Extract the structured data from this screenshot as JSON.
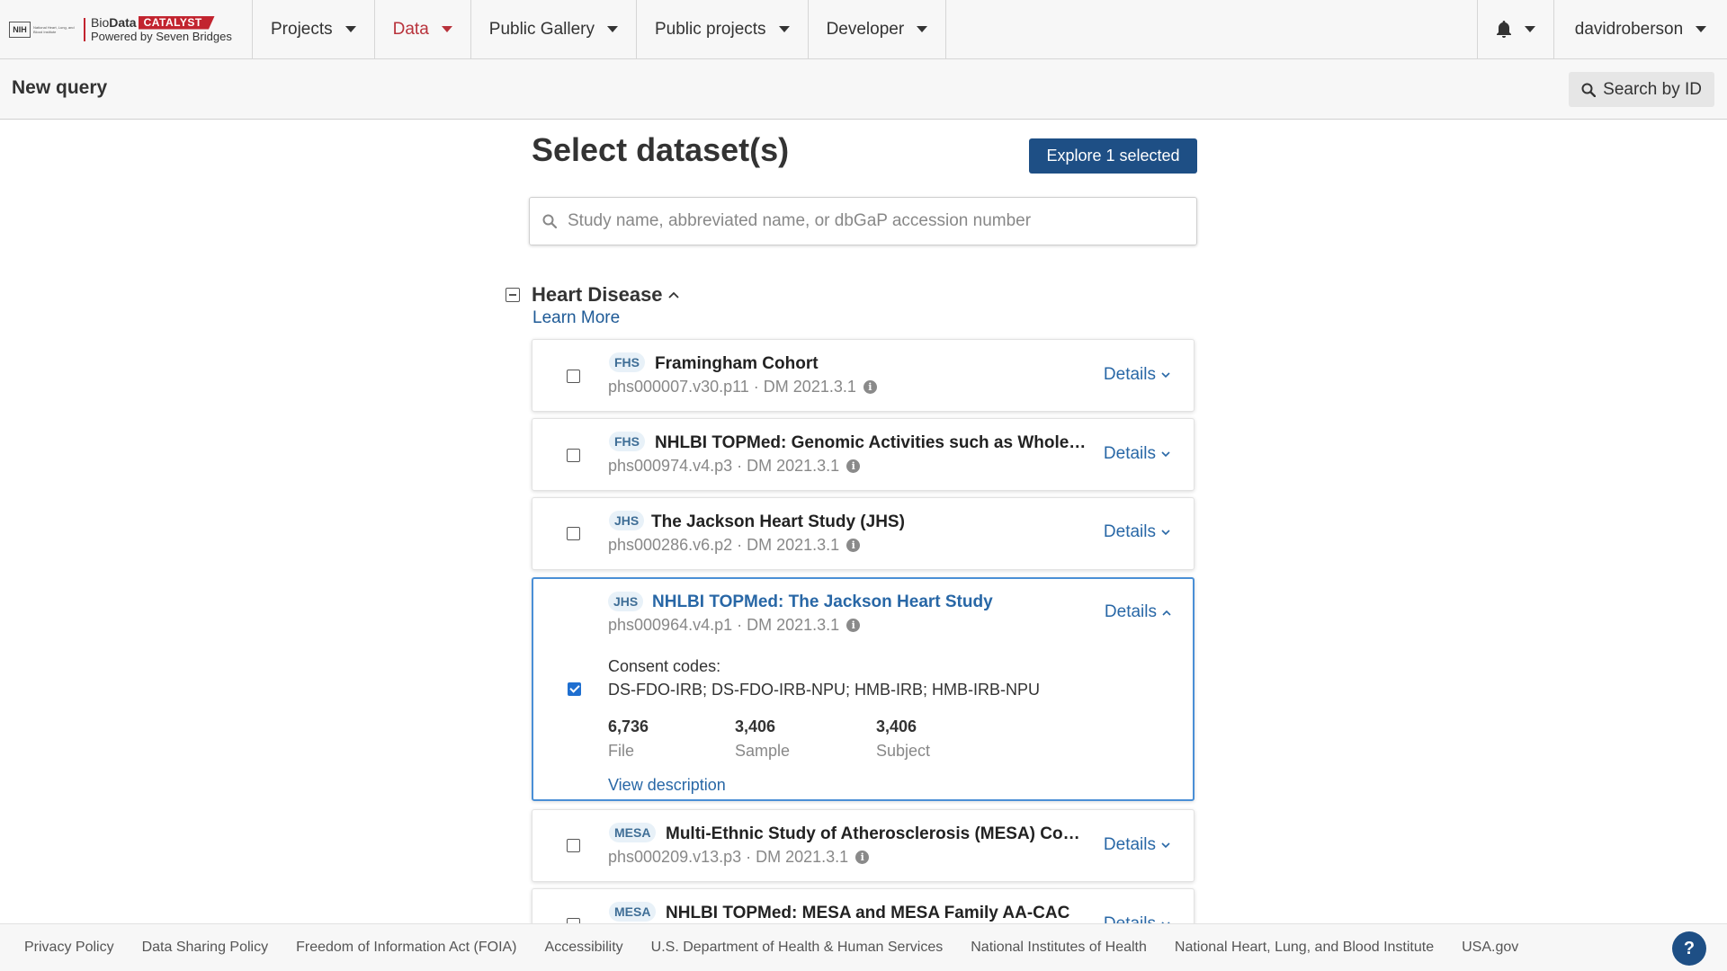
{
  "nav": {
    "brand": {
      "nih": "NIH",
      "nih_sub": "National Heart, Lung, and Blood Institute",
      "word1": "Bio",
      "word2": "Data",
      "pill": "CATALYST",
      "powered": "Powered by Seven Bridges"
    },
    "items": [
      {
        "label": "Projects"
      },
      {
        "label": "Data",
        "active": true
      },
      {
        "label": "Public Gallery"
      },
      {
        "label": "Public projects"
      },
      {
        "label": "Developer"
      }
    ],
    "user": "davidroberson"
  },
  "subheader": {
    "title": "New query",
    "search_by_id": "Search by ID"
  },
  "main": {
    "heading": "Select dataset(s)",
    "explore_button": "Explore 1 selected",
    "search_placeholder": "Study name, abbreviated name, or dbGaP accession number",
    "category": {
      "title": "Heart Disease",
      "learn_more": "Learn More"
    },
    "studies": [
      {
        "tag": "FHS",
        "title": "Framingham Cohort",
        "meta": "phs000007.v30.p11 · DM 2021.3.1",
        "details": "Details",
        "checked": false
      },
      {
        "tag": "FHS",
        "title": "NHLBI TOPMed: Genomic Activities such as Whole…",
        "meta": "phs000974.v4.p3 · DM 2021.3.1",
        "details": "Details",
        "checked": false
      },
      {
        "tag": "JHS",
        "title": "The Jackson Heart Study (JHS)",
        "meta": "phs000286.v6.p2 · DM 2021.3.1",
        "details": "Details",
        "checked": false
      },
      {
        "tag": "JHS",
        "title": "NHLBI TOPMed: The Jackson Heart Study",
        "meta": "phs000964.v4.p1 · DM 2021.3.1",
        "details": "Details",
        "checked": true,
        "consent_label": "Consent codes:",
        "consent_codes": "DS-FDO-IRB; DS-FDO-IRB-NPU; HMB-IRB; HMB-IRB-NPU",
        "stats": [
          {
            "value": "6,736",
            "label": "File"
          },
          {
            "value": "3,406",
            "label": "Sample"
          },
          {
            "value": "3,406",
            "label": "Subject"
          }
        ],
        "view_description": "View description"
      },
      {
        "tag": "MESA",
        "title": "Multi-Ethnic Study of Atherosclerosis (MESA) Co…",
        "meta": "phs000209.v13.p3 · DM 2021.3.1",
        "details": "Details",
        "checked": false
      },
      {
        "tag": "MESA",
        "title": "NHLBI TOPMed: MESA and MESA Family AA-CAC",
        "details": "Details",
        "checked": false
      }
    ]
  },
  "footer": {
    "links": [
      "Privacy Policy",
      "Data Sharing Policy",
      "Freedom of Information Act (FOIA)",
      "Accessibility",
      "U.S. Department of Health & Human Services",
      "National Institutes of Health",
      "National Heart, Lung, and Blood Institute",
      "USA.gov"
    ],
    "help": "?"
  },
  "colors": {
    "brand_red": "#c2242f",
    "primary_blue": "#1e4f85",
    "link_blue": "#2867a6",
    "selected_border": "#4a8fd6"
  }
}
